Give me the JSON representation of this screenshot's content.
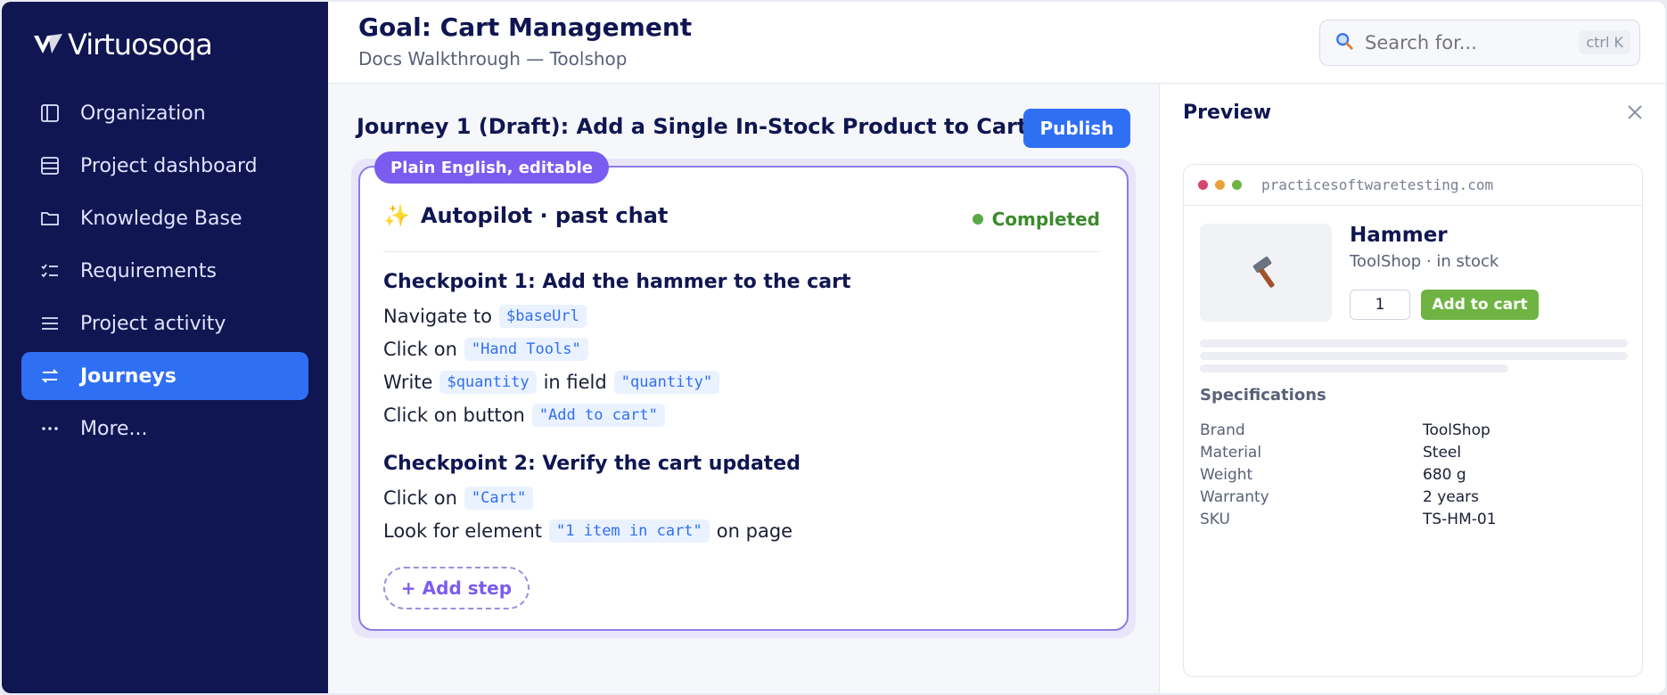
{
  "brand": {
    "name": "Virtuosoqa"
  },
  "sidebar": {
    "items": [
      {
        "label": "Organization",
        "icon": "panel-icon"
      },
      {
        "label": "Project dashboard",
        "icon": "dashboard-icon"
      },
      {
        "label": "Knowledge Base",
        "icon": "folder-icon"
      },
      {
        "label": "Requirements",
        "icon": "checklist-icon"
      },
      {
        "label": "Project activity",
        "icon": "list-icon"
      },
      {
        "label": "Journeys",
        "icon": "swap-arrows-icon",
        "active": true
      },
      {
        "label": "More...",
        "icon": "ellipsis-icon"
      }
    ]
  },
  "header": {
    "title": "Goal: Cart Management",
    "subtitle": "Docs Walkthrough — Toolshop",
    "search_placeholder": "Search for...",
    "search_shortcut": "ctrl K"
  },
  "journey": {
    "title": "Journey 1 (Draft): Add a Single In-Stock Product to Cart",
    "publish_label": "Publish",
    "badge": "Plain English, editable",
    "autopilot_icon": "✨",
    "autopilot_label": "Autopilot · past chat",
    "status": "Completed",
    "checkpoint1": {
      "title": "Checkpoint 1: Add the hammer to the cart",
      "steps": [
        {
          "pre": "Navigate to",
          "code": "$baseUrl"
        },
        {
          "pre": "Click on",
          "code": "\"Hand Tools\""
        },
        {
          "pre": "Write",
          "code": "$quantity",
          "mid": "in field",
          "code2": "\"quantity\""
        },
        {
          "pre": "Click on button",
          "code": "\"Add to cart\""
        }
      ]
    },
    "checkpoint2": {
      "title": "Checkpoint 2: Verify the cart updated",
      "steps": [
        {
          "pre": "Click on",
          "code": "\"Cart\""
        },
        {
          "pre": "Look for element",
          "code": "\"1 item in cart\"",
          "post": "on page"
        }
      ]
    },
    "add_step_label": "+ Add step"
  },
  "preview": {
    "title": "Preview",
    "url": "practicesoftwaretesting.com",
    "product": {
      "name": "Hammer",
      "meta": "ToolShop · in stock",
      "quantity": "1",
      "add_to_cart": "Add to cart"
    },
    "specs_title": "Specifications",
    "specs": [
      {
        "key": "Brand",
        "value": "ToolShop"
      },
      {
        "key": "Material",
        "value": "Steel"
      },
      {
        "key": "Weight",
        "value": "680 g"
      },
      {
        "key": "Warranty",
        "value": "2 years"
      },
      {
        "key": "SKU",
        "value": "TS-HM-01"
      }
    ]
  },
  "colors": {
    "sidebar_bg": "#0f1651",
    "accent": "#2f6ff4",
    "purple": "#7b5cf0",
    "success": "#5aa847",
    "cart_green": "#6fb443"
  }
}
